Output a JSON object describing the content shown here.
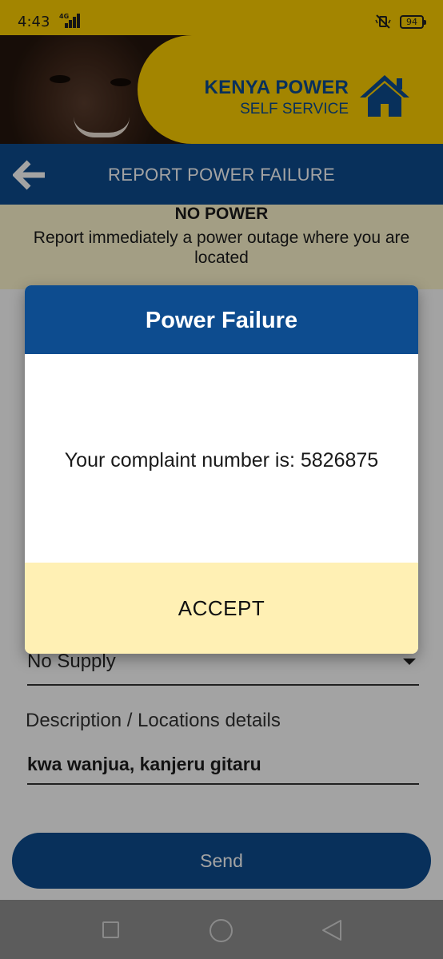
{
  "status_bar": {
    "time": "4:43",
    "network": "4G",
    "battery": "94"
  },
  "hero": {
    "brand_title": "KENYA POWER",
    "brand_subtitle": "SELF SERVICE"
  },
  "app_bar": {
    "title": "REPORT POWER FAILURE"
  },
  "info_banner": {
    "title": "NO POWER",
    "text": "Report immediately a power outage where you are located"
  },
  "form": {
    "failure_type_value": "No Supply",
    "description_label": "Description / Locations details",
    "description_value": "kwa wanjua, kanjeru gitaru",
    "send_label": "Send"
  },
  "dialog": {
    "title": "Power Failure",
    "message": "Your complaint number is: 5826875",
    "accept_label": "ACCEPT"
  },
  "colors": {
    "brand_yellow": "#ffd100",
    "brand_blue": "#0d4c8f",
    "dialog_footer": "#fff0b4",
    "banner": "#fff7cf"
  },
  "icons": [
    "back-arrow-icon",
    "house-icon",
    "mute-icon",
    "signal-icon",
    "battery-icon",
    "nav-recents-icon",
    "nav-home-icon",
    "nav-back-icon",
    "dropdown-caret-icon"
  ]
}
